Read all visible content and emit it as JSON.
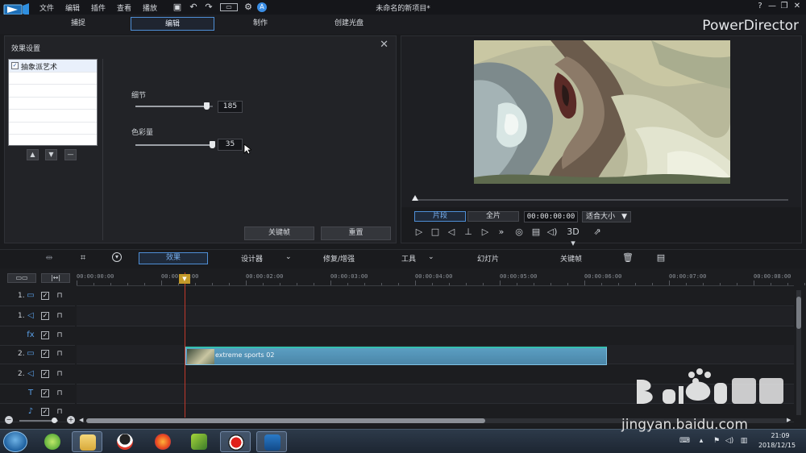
{
  "menu": {
    "file": "文件",
    "edit": "编辑",
    "plugins": "插件",
    "view": "查看",
    "playback": "播放"
  },
  "window": {
    "title": "未命名的新项目*",
    "help": "?",
    "minimize": "—",
    "restore": "❐",
    "close": "✕"
  },
  "modes": {
    "capture": "捕捉",
    "edit": "编辑",
    "produce": "制作",
    "disc": "创建光盘"
  },
  "brand": "PowerDirector",
  "effect_settings": {
    "title": "效果设置",
    "effect_item": "抽象派艺术",
    "params": [
      {
        "label": "细节",
        "value": "185",
        "level": 0.92
      },
      {
        "label": "色彩量",
        "value": "35",
        "level": 0.99
      }
    ],
    "keyframe_btn": "关键帧",
    "reset_btn": "重置"
  },
  "preview": {
    "clip_tab": "片段",
    "full_tab": "全片",
    "timecode": "00:00:00:00",
    "fit": "适合大小",
    "mode_3d": "3D"
  },
  "timeline_toolbar": {
    "effects": "效果",
    "designer": "设计器",
    "fix_enhance": "修复/增强",
    "tools": "工具",
    "slideshow": "幻灯片",
    "keyframe": "关键帧"
  },
  "ruler": [
    "00:00:00:00",
    "00:00:01:00",
    "00:00:02:00",
    "00:00:03:00",
    "00:00:04:00",
    "00:00:05:00",
    "00:00:06:00",
    "00:00:07:00",
    "00:00:08:00"
  ],
  "tracks": [
    {
      "num": "1.",
      "icon": "video-track-icon",
      "glyph": "▭"
    },
    {
      "num": "1.",
      "icon": "audio-track-icon",
      "glyph": "◁"
    },
    {
      "num": "",
      "icon": "fx-track-icon",
      "glyph": "fx"
    },
    {
      "num": "2.",
      "icon": "video-track-icon",
      "glyph": "▭"
    },
    {
      "num": "2.",
      "icon": "audio-track-icon",
      "glyph": "◁"
    },
    {
      "num": "",
      "icon": "title-track-icon",
      "glyph": "T"
    },
    {
      "num": "",
      "icon": "voice-track-icon",
      "glyph": "♪"
    }
  ],
  "clip": {
    "label": "extreme sports 02"
  },
  "taskbar": {
    "time": "21:09",
    "date": "2018/12/15"
  },
  "watermark": {
    "url": "jingyan.baidu.com"
  }
}
